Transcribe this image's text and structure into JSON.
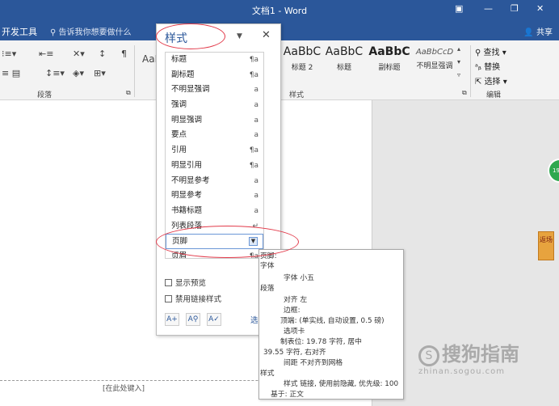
{
  "titlebar": {
    "title": "文档1 - Word"
  },
  "tabs": {
    "developer": "开发工具",
    "tell_me": "告诉我你想要做什么",
    "share": "共享"
  },
  "ribbon": {
    "paragraph_group": "段落",
    "styles_group": "样式",
    "editing_group": "编辑",
    "gallery": [
      {
        "sample": "AaBbC",
        "name": "标题 2"
      },
      {
        "sample": "AaBbC",
        "name": "标题"
      },
      {
        "sample": "AaBbC",
        "name": "副标题"
      },
      {
        "sample": "AaBbCcD",
        "name": "不明显强调"
      }
    ],
    "gallery_left_sample": "AaB",
    "find": "查找",
    "replace": "替换",
    "select": "选择"
  },
  "styles_pane": {
    "title": "样式",
    "items": [
      {
        "label": "标题",
        "mark": "¶a"
      },
      {
        "label": "副标题",
        "mark": "¶a"
      },
      {
        "label": "不明显强调",
        "mark": "a"
      },
      {
        "label": "强调",
        "mark": "a"
      },
      {
        "label": "明显强调",
        "mark": "a"
      },
      {
        "label": "要点",
        "mark": "a"
      },
      {
        "label": "引用",
        "mark": "¶a"
      },
      {
        "label": "明显引用",
        "mark": "¶a"
      },
      {
        "label": "不明显参考",
        "mark": "a"
      },
      {
        "label": "明显参考",
        "mark": "a"
      },
      {
        "label": "书籍标题",
        "mark": "a"
      },
      {
        "label": "列表段落",
        "mark": "↵"
      },
      {
        "label": "页脚",
        "mark": ""
      },
      {
        "label": "页眉",
        "mark": "¶a"
      }
    ],
    "show_preview": "显示预览",
    "disable_linked": "禁用链接样式",
    "options_link": "选"
  },
  "tooltip": {
    "header": "页脚:",
    "lines": [
      "字体",
      "字体 小五",
      "段落",
      "对齐 左",
      "边框:",
      "顶端: (单实线, 自动设置, 0.5 磅)",
      "选项卡",
      "制表位: 19.78 字符, 居中",
      "39.55 字符, 右对齐",
      "间距 不对齐到网格",
      "样式",
      "样式 链接, 使用前隐藏, 优先级: 100",
      "基于: 正文"
    ]
  },
  "document": {
    "footer_hint": "[在此处键入]"
  },
  "side_badge": "19",
  "side_tag": "返场",
  "watermark": {
    "main": "搜狗指南",
    "sub": "zhinan.sogou.com"
  },
  "colors": {
    "accent": "#2b579a",
    "annotation": "#e23a4a"
  }
}
